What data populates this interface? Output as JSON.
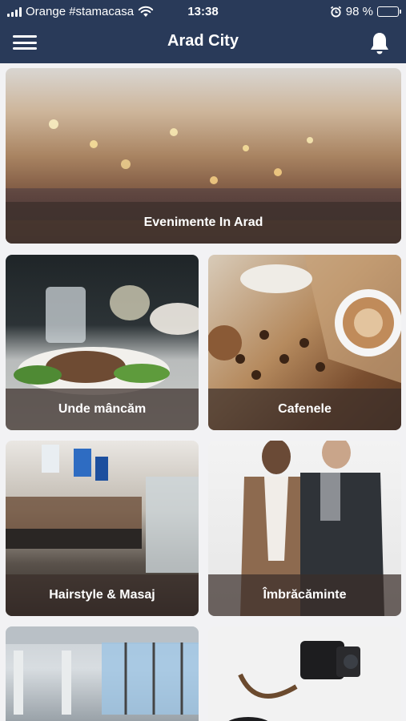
{
  "status_bar": {
    "carrier": "Orange #stamacasa",
    "time": "13:38",
    "battery_percent": "98 %",
    "signal_icon": "signal-bars-icon",
    "wifi_icon": "wifi-icon",
    "alarm_icon": "alarm-clock-icon",
    "battery_level": 0.98
  },
  "nav": {
    "title": "Arad City",
    "menu_icon": "hamburger-menu-icon",
    "notifications_icon": "bell-icon"
  },
  "categories": [
    {
      "label": "Evenimente In Arad"
    },
    {
      "label": "Unde mâncăm"
    },
    {
      "label": "Cafenele"
    },
    {
      "label": "Hairstyle & Masaj"
    },
    {
      "label": "Îmbrăcăminte"
    },
    {
      "label": ""
    },
    {
      "label": ""
    }
  ],
  "colors": {
    "header_bg": "#293a59",
    "label_overlay": "#3a2e2a",
    "battery_green": "#4cd964"
  }
}
